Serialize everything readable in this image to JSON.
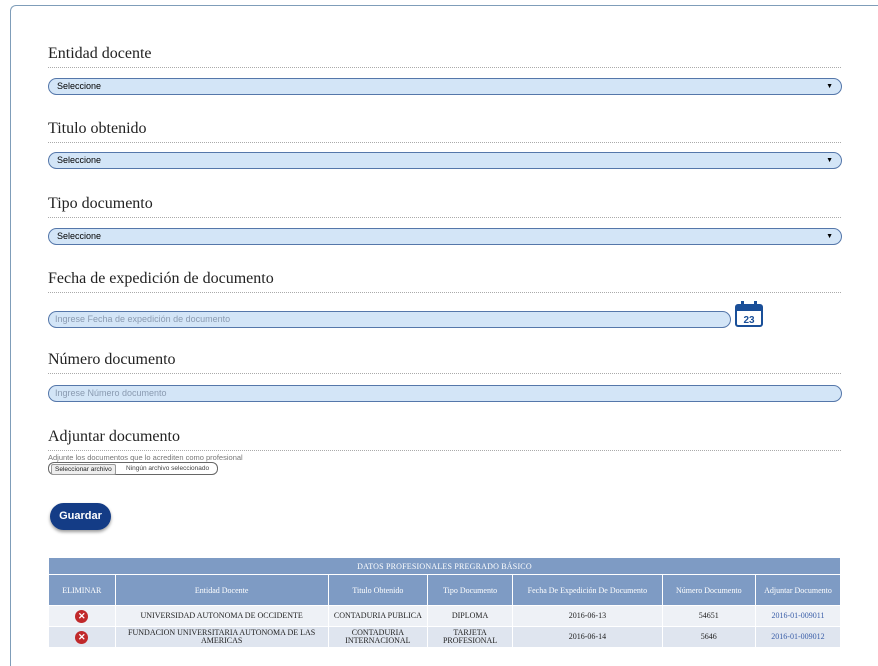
{
  "form": {
    "entidad": {
      "label": "Entidad docente",
      "value": "Seleccione"
    },
    "titulo": {
      "label": "Titulo obtenido",
      "value": "Seleccione"
    },
    "tipo": {
      "label": "Tipo documento",
      "value": "Seleccione"
    },
    "fecha": {
      "label": "Fecha de expedición de documento",
      "placeholder": "Ingrese Fecha de expedición de documento",
      "calendar_day": "23"
    },
    "numero": {
      "label": "Número documento",
      "placeholder": "Ingrese Número documento"
    },
    "adjuntar": {
      "label": "Adjuntar documento",
      "hint": "Adjunte los documentos que lo acrediten como profesional",
      "button": "Seleccionar archivo",
      "status": "Ningún archivo seleccionado"
    },
    "save_label": "Guardar"
  },
  "table": {
    "title": "DATOS PROFESIONALES PREGRADO BÁSICO",
    "columns": [
      "ELIMINAR",
      "Entidad Docente",
      "Titulo Obtenido",
      "Tipo Documento",
      "Fecha De Expedición De Documento",
      "Número Documento",
      "Adjuntar Documento"
    ],
    "rows": [
      {
        "entidad": "UNIVERSIDAD AUTONOMA DE OCCIDENTE",
        "titulo": "CONTADURIA PUBLICA",
        "tipo": "DIPLOMA",
        "fecha": "2016-06-13",
        "numero": "54651",
        "adjunto": "2016-01-009011"
      },
      {
        "entidad": "FUNDACION UNIVERSITARIA AUTONOMA DE LAS AMERICAS",
        "titulo": "CONTADURIA INTERNACIONAL",
        "tipo": "TARJETA PROFESIONAL",
        "fecha": "2016-06-14",
        "numero": "5646",
        "adjunto": "2016-01-009012"
      }
    ]
  },
  "colors": {
    "field_bg": "#d3e5f7",
    "button": "#143c86",
    "table_header": "#7e9bc4",
    "delete": "#c0292b"
  },
  "icons": {
    "calendar": "calendar-icon",
    "delete": "delete-icon",
    "dropdown": "dropdown-arrow-icon"
  }
}
